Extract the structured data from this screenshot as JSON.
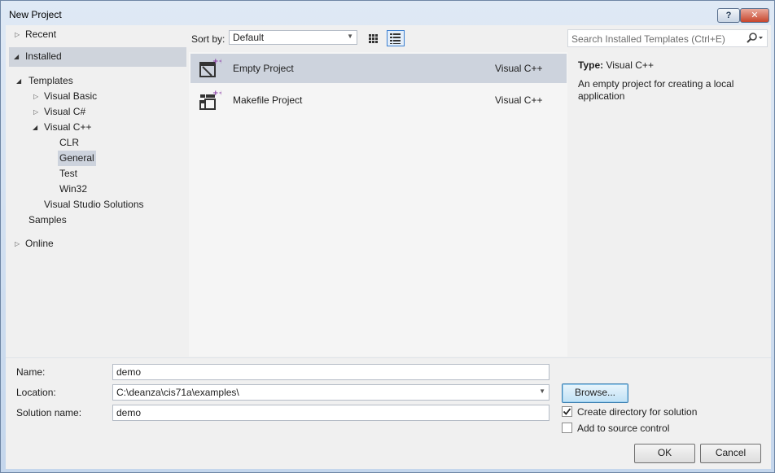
{
  "window": {
    "title": "New Project",
    "help_label": "?",
    "close_label": "✕"
  },
  "nav": {
    "recent": "Recent",
    "installed": "Installed",
    "templates": "Templates",
    "visual_basic": "Visual Basic",
    "visual_csharp": "Visual C#",
    "visual_cpp": "Visual C++",
    "clr": "CLR",
    "general": "General",
    "test": "Test",
    "win32": "Win32",
    "vs_solutions": "Visual Studio Solutions",
    "samples": "Samples",
    "online": "Online"
  },
  "sort": {
    "label": "Sort by:",
    "value": "Default"
  },
  "search": {
    "placeholder": "Search Installed Templates (Ctrl+E)"
  },
  "templates": [
    {
      "name": "Empty Project",
      "language": "Visual C++",
      "icon": "empty-project-icon",
      "selected": true
    },
    {
      "name": "Makefile Project",
      "language": "Visual C++",
      "icon": "makefile-project-icon",
      "selected": false
    }
  ],
  "description": {
    "type_label": "Type:",
    "type_value": "Visual C++",
    "text": "An empty project for creating a local application"
  },
  "form": {
    "name_label": "Name:",
    "name_value": "demo",
    "location_label": "Location:",
    "location_value": "C:\\deanza\\cis71a\\examples\\",
    "solution_label": "Solution name:",
    "solution_value": "demo",
    "browse_label": "Browse...",
    "create_dir_label": "Create directory for solution",
    "create_dir_checked": true,
    "source_control_label": "Add to source control",
    "source_control_checked": false,
    "ok_label": "OK",
    "cancel_label": "Cancel"
  },
  "colors": {
    "selection": "#cdd3dd",
    "accent": "#3b7fd0"
  }
}
